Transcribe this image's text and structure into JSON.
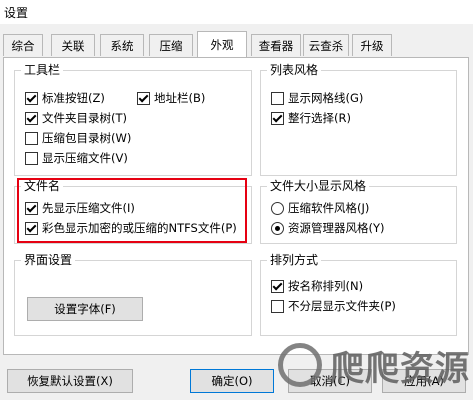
{
  "window": {
    "title": "设置"
  },
  "tabs": [
    {
      "label": "综合"
    },
    {
      "label": "关联"
    },
    {
      "label": "系统"
    },
    {
      "label": "压缩"
    },
    {
      "label": "外观",
      "active": true
    },
    {
      "label": "查看器"
    },
    {
      "label": "云查杀"
    },
    {
      "label": "升级"
    }
  ],
  "toolbar_group": {
    "title": "工具栏",
    "options": [
      {
        "label": "标准按钮(Z)",
        "checked": true
      },
      {
        "label": "地址栏(B)",
        "checked": true
      },
      {
        "label": "文件夹目录树(T)",
        "checked": true
      },
      {
        "label": "压缩包目录树(W)",
        "checked": false
      },
      {
        "label": "显示压缩文件(V)",
        "checked": false
      }
    ]
  },
  "list_style_group": {
    "title": "列表风格",
    "options": [
      {
        "label": "显示网格线(G)",
        "checked": false
      },
      {
        "label": "整行选择(R)",
        "checked": true
      }
    ]
  },
  "filename_group": {
    "title": "文件名",
    "options": [
      {
        "label": "先显示压缩文件(I)",
        "checked": true
      },
      {
        "label": "彩色显示加密的或压缩的NTFS文件(P)",
        "checked": true
      }
    ]
  },
  "filesize_group": {
    "title": "文件大小显示风格",
    "options": [
      {
        "label": "压缩软件风格(J)",
        "selected": false
      },
      {
        "label": "资源管理器风格(Y)",
        "selected": true
      }
    ]
  },
  "ui_group": {
    "title": "界面设置",
    "font_button": "设置字体(F)"
  },
  "sort_group": {
    "title": "排列方式",
    "options": [
      {
        "label": "按名称排列(N)",
        "checked": true
      },
      {
        "label": "不分层显示文件夹(P)",
        "checked": false
      }
    ]
  },
  "footer": {
    "restore_button": "恢复默认设置(X)",
    "ok_button": "确定(O)",
    "cancel_button": "取消(C)",
    "apply_button": "应用(A)"
  },
  "watermark": {
    "text": "爬爬资源"
  }
}
